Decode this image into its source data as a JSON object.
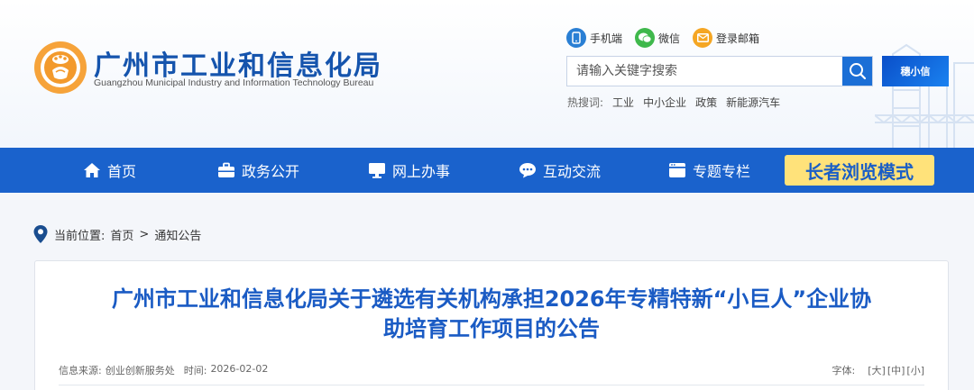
{
  "header": {
    "title": "广州市工业和信息化局",
    "subtitle": "Guangzhou Municipal Industry and Information Technology Bureau",
    "quick_links": [
      {
        "label": "手机端",
        "icon": "phone-icon",
        "color": "#2a7fd4"
      },
      {
        "label": "微信",
        "icon": "wechat-icon",
        "color": "#3fb84c"
      },
      {
        "label": "登录邮箱",
        "icon": "mail-icon",
        "color": "#f5a623"
      }
    ],
    "search": {
      "placeholder": "请输入关键字搜索",
      "value": ""
    },
    "mini_badge": "穗小信",
    "hot_search_label": "热搜词:",
    "hot_search": [
      "工业",
      "中小企业",
      "政策",
      "新能源汽车"
    ]
  },
  "nav": {
    "items": [
      {
        "label": "首页",
        "icon": "home-icon"
      },
      {
        "label": "政务公开",
        "icon": "briefcase-icon"
      },
      {
        "label": "网上办事",
        "icon": "monitor-icon"
      },
      {
        "label": "互动交流",
        "icon": "chat-icon"
      },
      {
        "label": "专题专栏",
        "icon": "browser-icon"
      }
    ],
    "elder_mode": "长者浏览模式"
  },
  "breadcrumb": {
    "label": "当前位置:",
    "home": "首页",
    "separator": ">",
    "current": "通知公告"
  },
  "article": {
    "title_line1": "广州市工业和信息化局关于遴选有关机构承担2026年专精特新“小巨人”企业协",
    "title_line2": "助培育工作项目的公告",
    "source_label": "信息来源:",
    "source": "创业创新服务处",
    "time_label": "时间:",
    "time": "2026-02-02",
    "font_label": "字体:",
    "font_sizes": [
      "[大]",
      "[中]",
      "[小]"
    ]
  },
  "colors": {
    "brand_blue": "#1a62cc",
    "title_blue": "#1a5bc4",
    "elder_yellow": "#ffe27a"
  }
}
